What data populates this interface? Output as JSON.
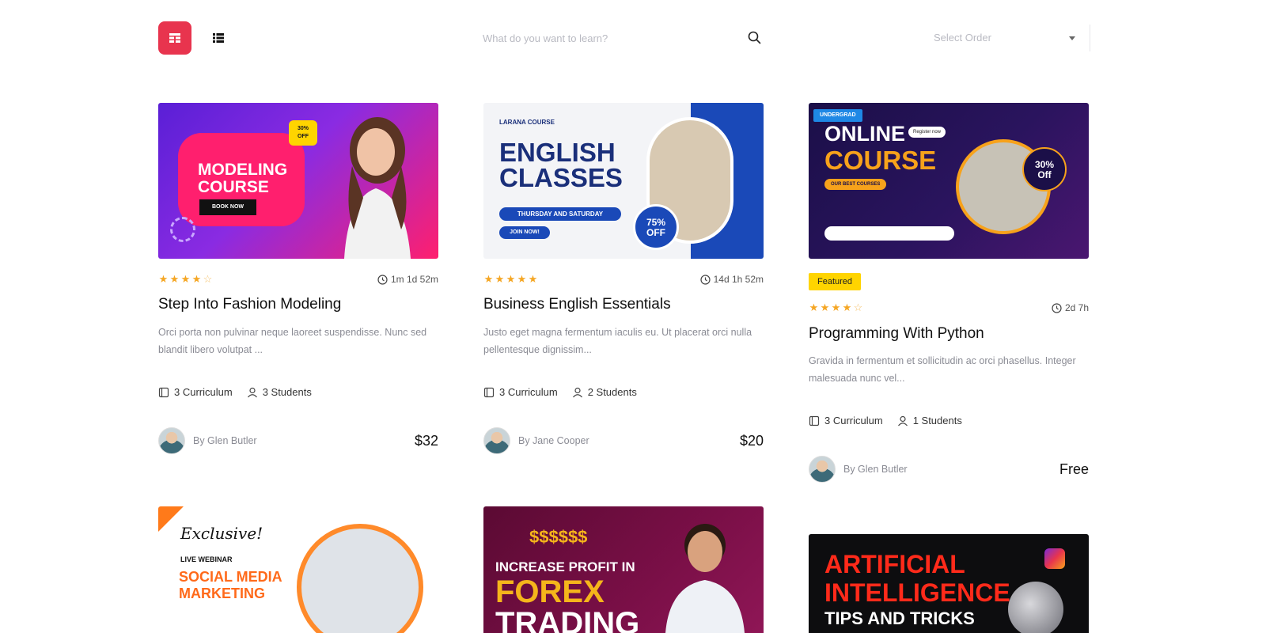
{
  "toolbar": {
    "grid_icon": "grid-icon",
    "list_icon": "list-icon",
    "search_placeholder": "What do you want to learn?",
    "search_icon": "search-icon",
    "select_order": "Select Order",
    "accent": "#e8344e"
  },
  "courses": [
    {
      "thumb": {
        "line1": "MODELING",
        "line2": "COURSE",
        "cta": "BOOK NOW",
        "off": "30%",
        "off2": "OFF"
      },
      "rating": 4,
      "duration": "1m 1d 52m",
      "title": "Step Into Fashion Modeling",
      "desc": "Orci porta non pulvinar neque laoreet suspendisse. Nunc sed blandit libero volutpat ...",
      "curriculum": "3 Curriculum",
      "students": "3 Students",
      "author": "By Glen Butler",
      "price": "$32"
    },
    {
      "thumb": {
        "brand": "LARANA COURSE",
        "line1": "ENGLISH",
        "line2": "CLASSES",
        "days": "THURSDAY AND SATURDAY",
        "cta": "JOIN NOW!",
        "off": "75%",
        "off2": "OFF"
      },
      "rating": 5,
      "duration": "14d 1h 52m",
      "title": "Business English Essentials",
      "desc": "Justo eget magna fermentum iaculis eu. Ut placerat orci nulla pellentesque dignissim...",
      "curriculum": "3 Curriculum",
      "students": "2 Students",
      "author": "By Jane Cooper",
      "price": "$20"
    },
    {
      "thumb": {
        "tag": "UNDERGRAD",
        "line1": "ONLINE",
        "line2": "COURSE",
        "register": "Register now",
        "best": "OUR BEST COURSES",
        "off": "30%",
        "off2": "Off"
      },
      "badge": "Featured",
      "rating": 4,
      "duration": "2d 7h",
      "title": "Programming With Python",
      "desc": "Gravida in fermentum et sollicitudin ac orci phasellus. Integer malesuada nunc vel...",
      "curriculum": "3 Curriculum",
      "students": "1 Students",
      "author": "By Glen Butler",
      "price": "Free"
    },
    {
      "thumb": {
        "script": "Exclusive!",
        "sub": "LIVE WEBINAR",
        "line1": "SOCIAL MEDIA",
        "line2": "MARKETING"
      }
    },
    {
      "thumb": {
        "dollars": "$$$$$$",
        "line1": "INCREASE PROFIT IN",
        "line2": "FOREX",
        "line3": "TRADING"
      }
    },
    {
      "thumb": {
        "line1": "ARTIFICIAL",
        "line2": "INTELLIGENCE",
        "line3": "TIPS AND TRICKS"
      }
    }
  ],
  "icons": {
    "clock": "clock-icon",
    "book": "book-icon",
    "user": "user-icon",
    "star": "star-icon"
  }
}
